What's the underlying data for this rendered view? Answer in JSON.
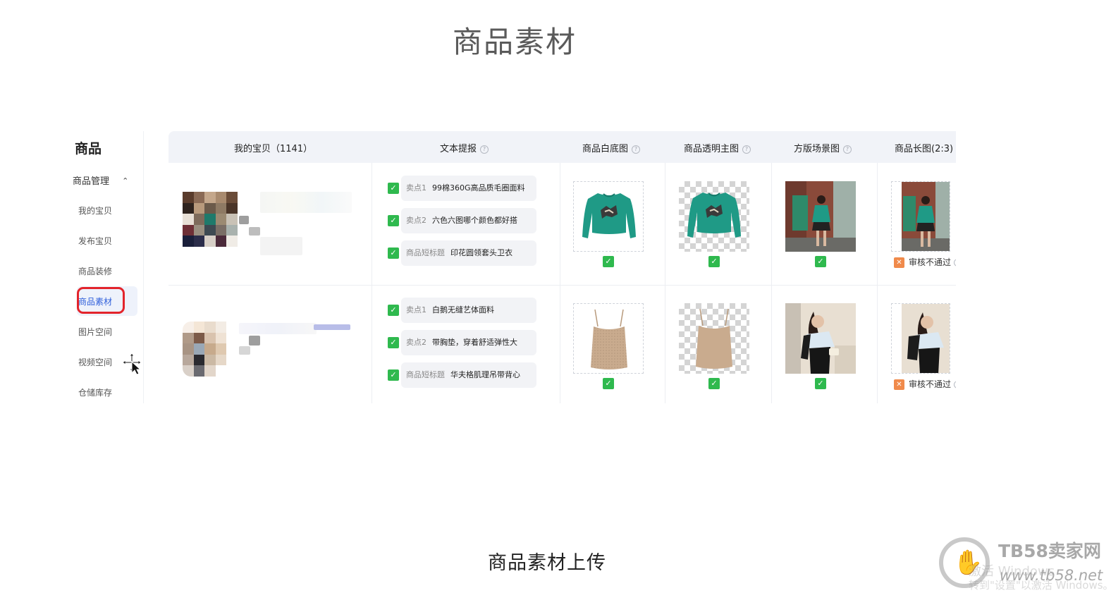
{
  "slide": {
    "title": "商品素材",
    "caption": "商品素材上传"
  },
  "sidebar": {
    "title": "商品",
    "group": {
      "label": "商品管理",
      "chevron": "chevron-up-icon"
    },
    "items": [
      {
        "label": "我的宝贝"
      },
      {
        "label": "发布宝贝"
      },
      {
        "label": "商品装修"
      },
      {
        "label": "商品素材",
        "active": true
      },
      {
        "label": "图片空间"
      },
      {
        "label": "视频空间"
      },
      {
        "label": "仓储库存"
      }
    ],
    "highlight_color": "#e3242b",
    "active_color": "#2f5fdb"
  },
  "table": {
    "columns": [
      {
        "label": "我的宝贝（1141）"
      },
      {
        "label": "文本提报",
        "help": true
      },
      {
        "label": "商品白底图",
        "help": true
      },
      {
        "label": "商品透明主图",
        "help": true
      },
      {
        "label": "方版场景图",
        "help": true
      },
      {
        "label": "商品长图(2:3)"
      }
    ],
    "rows": [
      {
        "texts": [
          {
            "key": "卖点1",
            "value": "99棉360G高品质毛圈面料"
          },
          {
            "key": "卖点2",
            "value": "六色六图哪个颜色都好搭"
          },
          {
            "key": "商品短标题",
            "value": "印花圆领套头卫衣"
          }
        ],
        "white_bg_status": "approved",
        "transparent_status": "approved",
        "scene_status": "approved",
        "long_image_status": "审核不通过"
      },
      {
        "texts": [
          {
            "key": "卖点1",
            "value": "白鹅无缝艺体面料"
          },
          {
            "key": "卖点2",
            "value": "带胸垫，穿着舒适弹性大"
          },
          {
            "key": "商品短标题",
            "value": "华夫格肌理吊带背心"
          }
        ],
        "white_bg_status": "approved",
        "transparent_status": "approved",
        "scene_status": "approved",
        "long_image_status": "审核不通过"
      }
    ],
    "colors": {
      "approved": "#2fb94e",
      "rejected": "#f08a4b",
      "header_bg": "#f1f3f8"
    }
  },
  "watermark": {
    "brand": "TB58卖家网",
    "url": "www.tb58.net",
    "windows_line1": "激活 Windows",
    "windows_line2": "转到\"设置\"以激活 Windows。"
  }
}
